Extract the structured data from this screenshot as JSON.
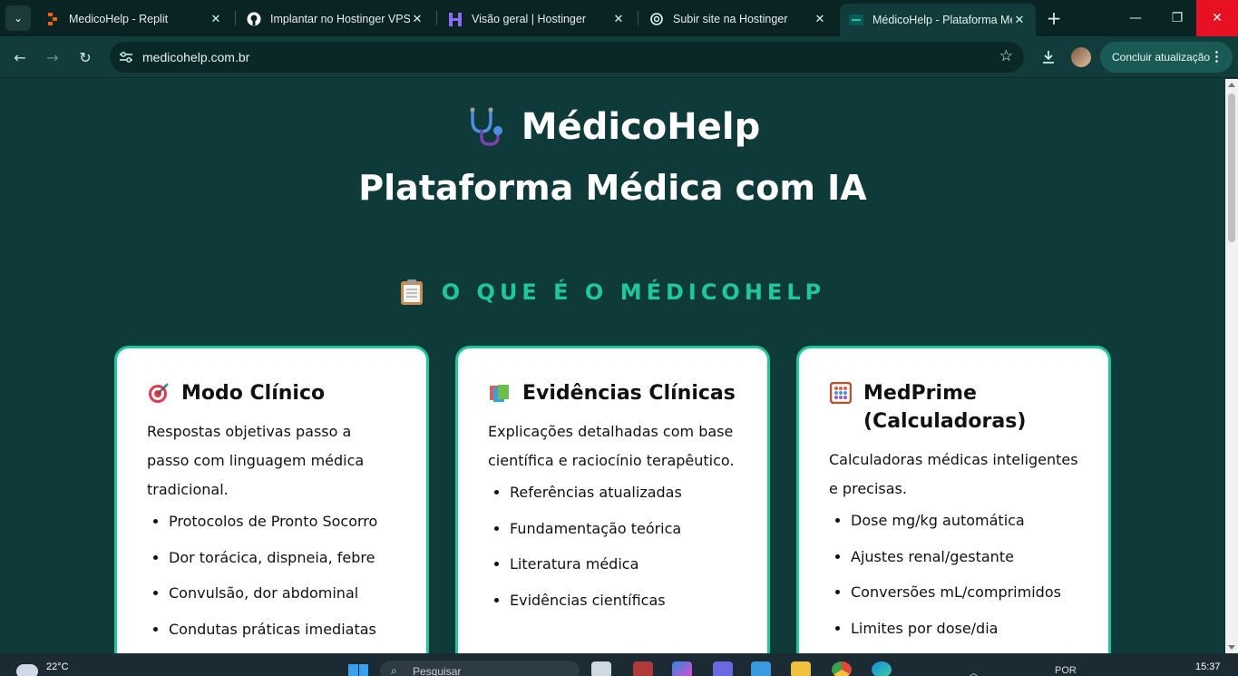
{
  "browser": {
    "tabs": [
      {
        "title": "MedicoHelp - Replit",
        "icon": "replit-icon",
        "active": false
      },
      {
        "title": "Implantar no Hostinger VPS",
        "icon": "github-icon",
        "active": false
      },
      {
        "title": "Visão geral | Hostinger",
        "icon": "hostinger-icon",
        "active": false
      },
      {
        "title": "Subir site na Hostinger",
        "icon": "chatgpt-icon",
        "active": false
      },
      {
        "title": "MédicoHelp - Plataforma Médica",
        "icon": "medicohelp-icon",
        "active": true
      }
    ],
    "tab_close": "✕",
    "new_tab": "+",
    "url": "medicohelp.com.br",
    "update_button": "Concluir atualização",
    "window_controls": {
      "minimize": "—",
      "restore": "❐",
      "close": "✕"
    }
  },
  "page": {
    "brand": "MédicoHelp",
    "tagline": "Plataforma Médica com IA",
    "section_title": "O QUE É O MÉDICOHELP",
    "cards": [
      {
        "icon": "target-icon",
        "title": "Modo Clínico",
        "description": "Respostas objetivas passo a passo com linguagem médica tradicional.",
        "items": [
          "Protocolos de Pronto Socorro",
          "Dor torácica, dispneia, febre",
          "Convulsão, dor abdominal",
          "Condutas práticas imediatas"
        ]
      },
      {
        "icon": "books-icon",
        "title": "Evidências Clínicas",
        "description": "Explicações detalhadas com base científica e raciocínio terapêutico.",
        "items": [
          "Referências atualizadas",
          "Fundamentação teórica",
          "Literatura médica",
          "Evidências científicas"
        ]
      },
      {
        "icon": "abacus-icon",
        "title": "MedPrime (Calculadoras)",
        "description": "Calculadoras médicas inteligentes e precisas.",
        "items": [
          "Dose mg/kg automática",
          "Ajustes renal/gestante",
          "Conversões mL/comprimidos",
          "Limites por dose/dia"
        ]
      }
    ]
  },
  "taskbar": {
    "temperature": "22°C",
    "search_placeholder": "Pesquisar",
    "language": "POR",
    "time": "15:37"
  },
  "colors": {
    "page_bg": "#0f3a3a",
    "accent": "#1fc79e",
    "card_bg": "#ffffff"
  }
}
